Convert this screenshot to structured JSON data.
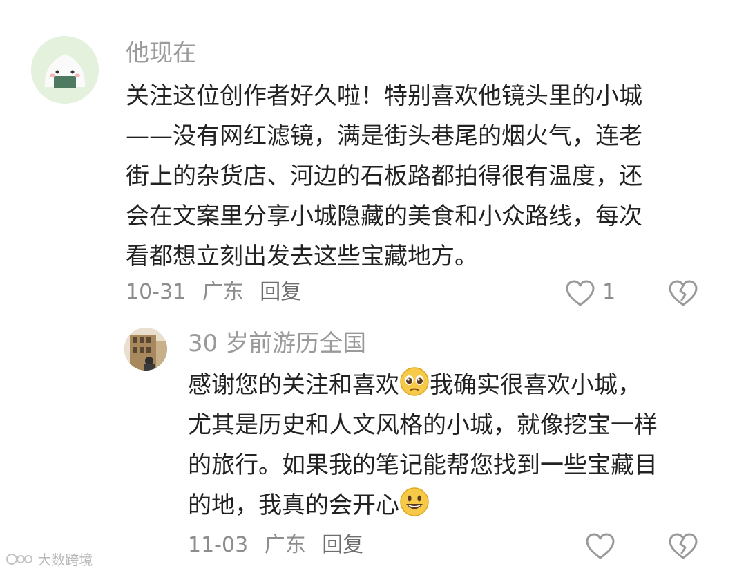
{
  "comment": {
    "username": "他现在",
    "lines": [
      "关注这位创作者好久啦！特别喜欢他镜头里的小城",
      "——没有网红滤镜，满是街头巷尾的烟火气，连老",
      "街上的杂货店、河边的石板路都拍得很有温度，还",
      "会在文案里分享小城隐藏的美食和小众路线，每次",
      "看都想立刻出发去这些宝藏地方。"
    ],
    "date": "10-31",
    "location": "广东",
    "reply_label": "回复",
    "like_count": "1"
  },
  "reply": {
    "username": "30 岁前游历全国",
    "line1_before": "感谢您的关注和喜欢",
    "line1_after": "我确实很喜欢小城，",
    "line2": "尤其是历史和人文风格的小城，就像挖宝一样",
    "line3": "的旅行。如果我的笔记能帮您找到一些宝藏目",
    "line4_before": "的地，我真的会开心",
    "date": "11-03",
    "location": "广东",
    "reply_label": "回复"
  },
  "watermark": "大数跨境",
  "icons": {
    "like": "heart-outline-icon",
    "dislike": "broken-heart-icon",
    "emoji1": "pleading-face-emoji",
    "emoji2": "smiling-face-emoji"
  }
}
